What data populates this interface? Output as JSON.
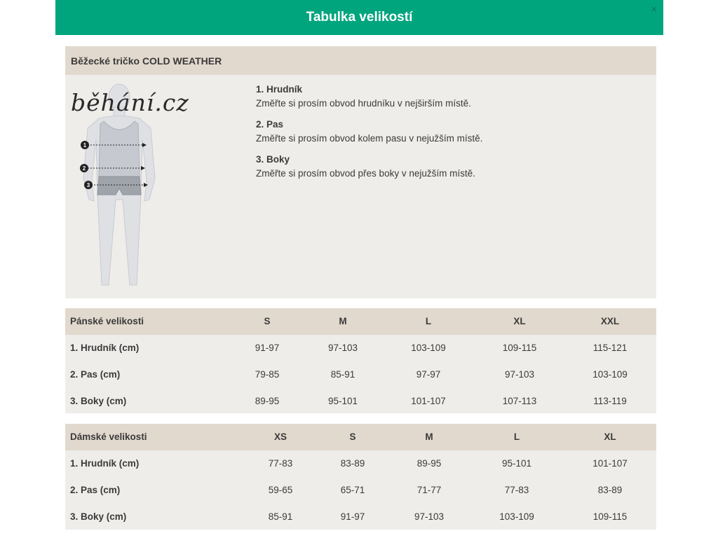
{
  "header": {
    "title": "Tabulka velikostí",
    "close_label": "×"
  },
  "product": {
    "title": "Běžecké tričko COLD WEATHER",
    "logo_text": "běhání.cz",
    "markers": [
      "1",
      "2",
      "3"
    ],
    "instructions": [
      {
        "title": "1. Hrudník",
        "text": "Změřte si prosím obvod hrudníku v nejširším místě."
      },
      {
        "title": "2. Pas",
        "text": "Změřte si prosím obvod kolem pasu v nejužším místě."
      },
      {
        "title": "3. Boky",
        "text": "Změřte si prosím obvod přes boky v nejužším místě."
      }
    ]
  },
  "mens_table": {
    "header_label": "Pánské velikosti",
    "sizes": [
      "S",
      "M",
      "L",
      "XL",
      "XXL"
    ],
    "rows": [
      {
        "label": "1. Hrudník (cm)",
        "values": [
          "91-97",
          "97-103",
          "103-109",
          "109-115",
          "115-121"
        ]
      },
      {
        "label": "2. Pas (cm)",
        "values": [
          "79-85",
          "85-91",
          "97-97",
          "97-103",
          "103-109"
        ]
      },
      {
        "label": "3. Boky (cm)",
        "values": [
          "89-95",
          "95-101",
          "101-107",
          "107-113",
          "113-119"
        ]
      }
    ]
  },
  "womens_table": {
    "header_label": "Dámské velikosti",
    "sizes": [
      "XS",
      "S",
      "M",
      "L",
      "XL"
    ],
    "rows": [
      {
        "label": "1. Hrudník (cm)",
        "values": [
          "77-83",
          "83-89",
          "89-95",
          "95-101",
          "101-107"
        ]
      },
      {
        "label": "2. Pas (cm)",
        "values": [
          "59-65",
          "65-71",
          "71-77",
          "77-83",
          "83-89"
        ]
      },
      {
        "label": "3. Boky (cm)",
        "values": [
          "85-91",
          "91-97",
          "97-103",
          "103-109",
          "109-115"
        ]
      }
    ]
  },
  "colors": {
    "header_bg": "#00a57e",
    "panel_bg": "#efedea",
    "panel_head_bg": "#e2d9ce",
    "text": "#3a3a3a"
  }
}
